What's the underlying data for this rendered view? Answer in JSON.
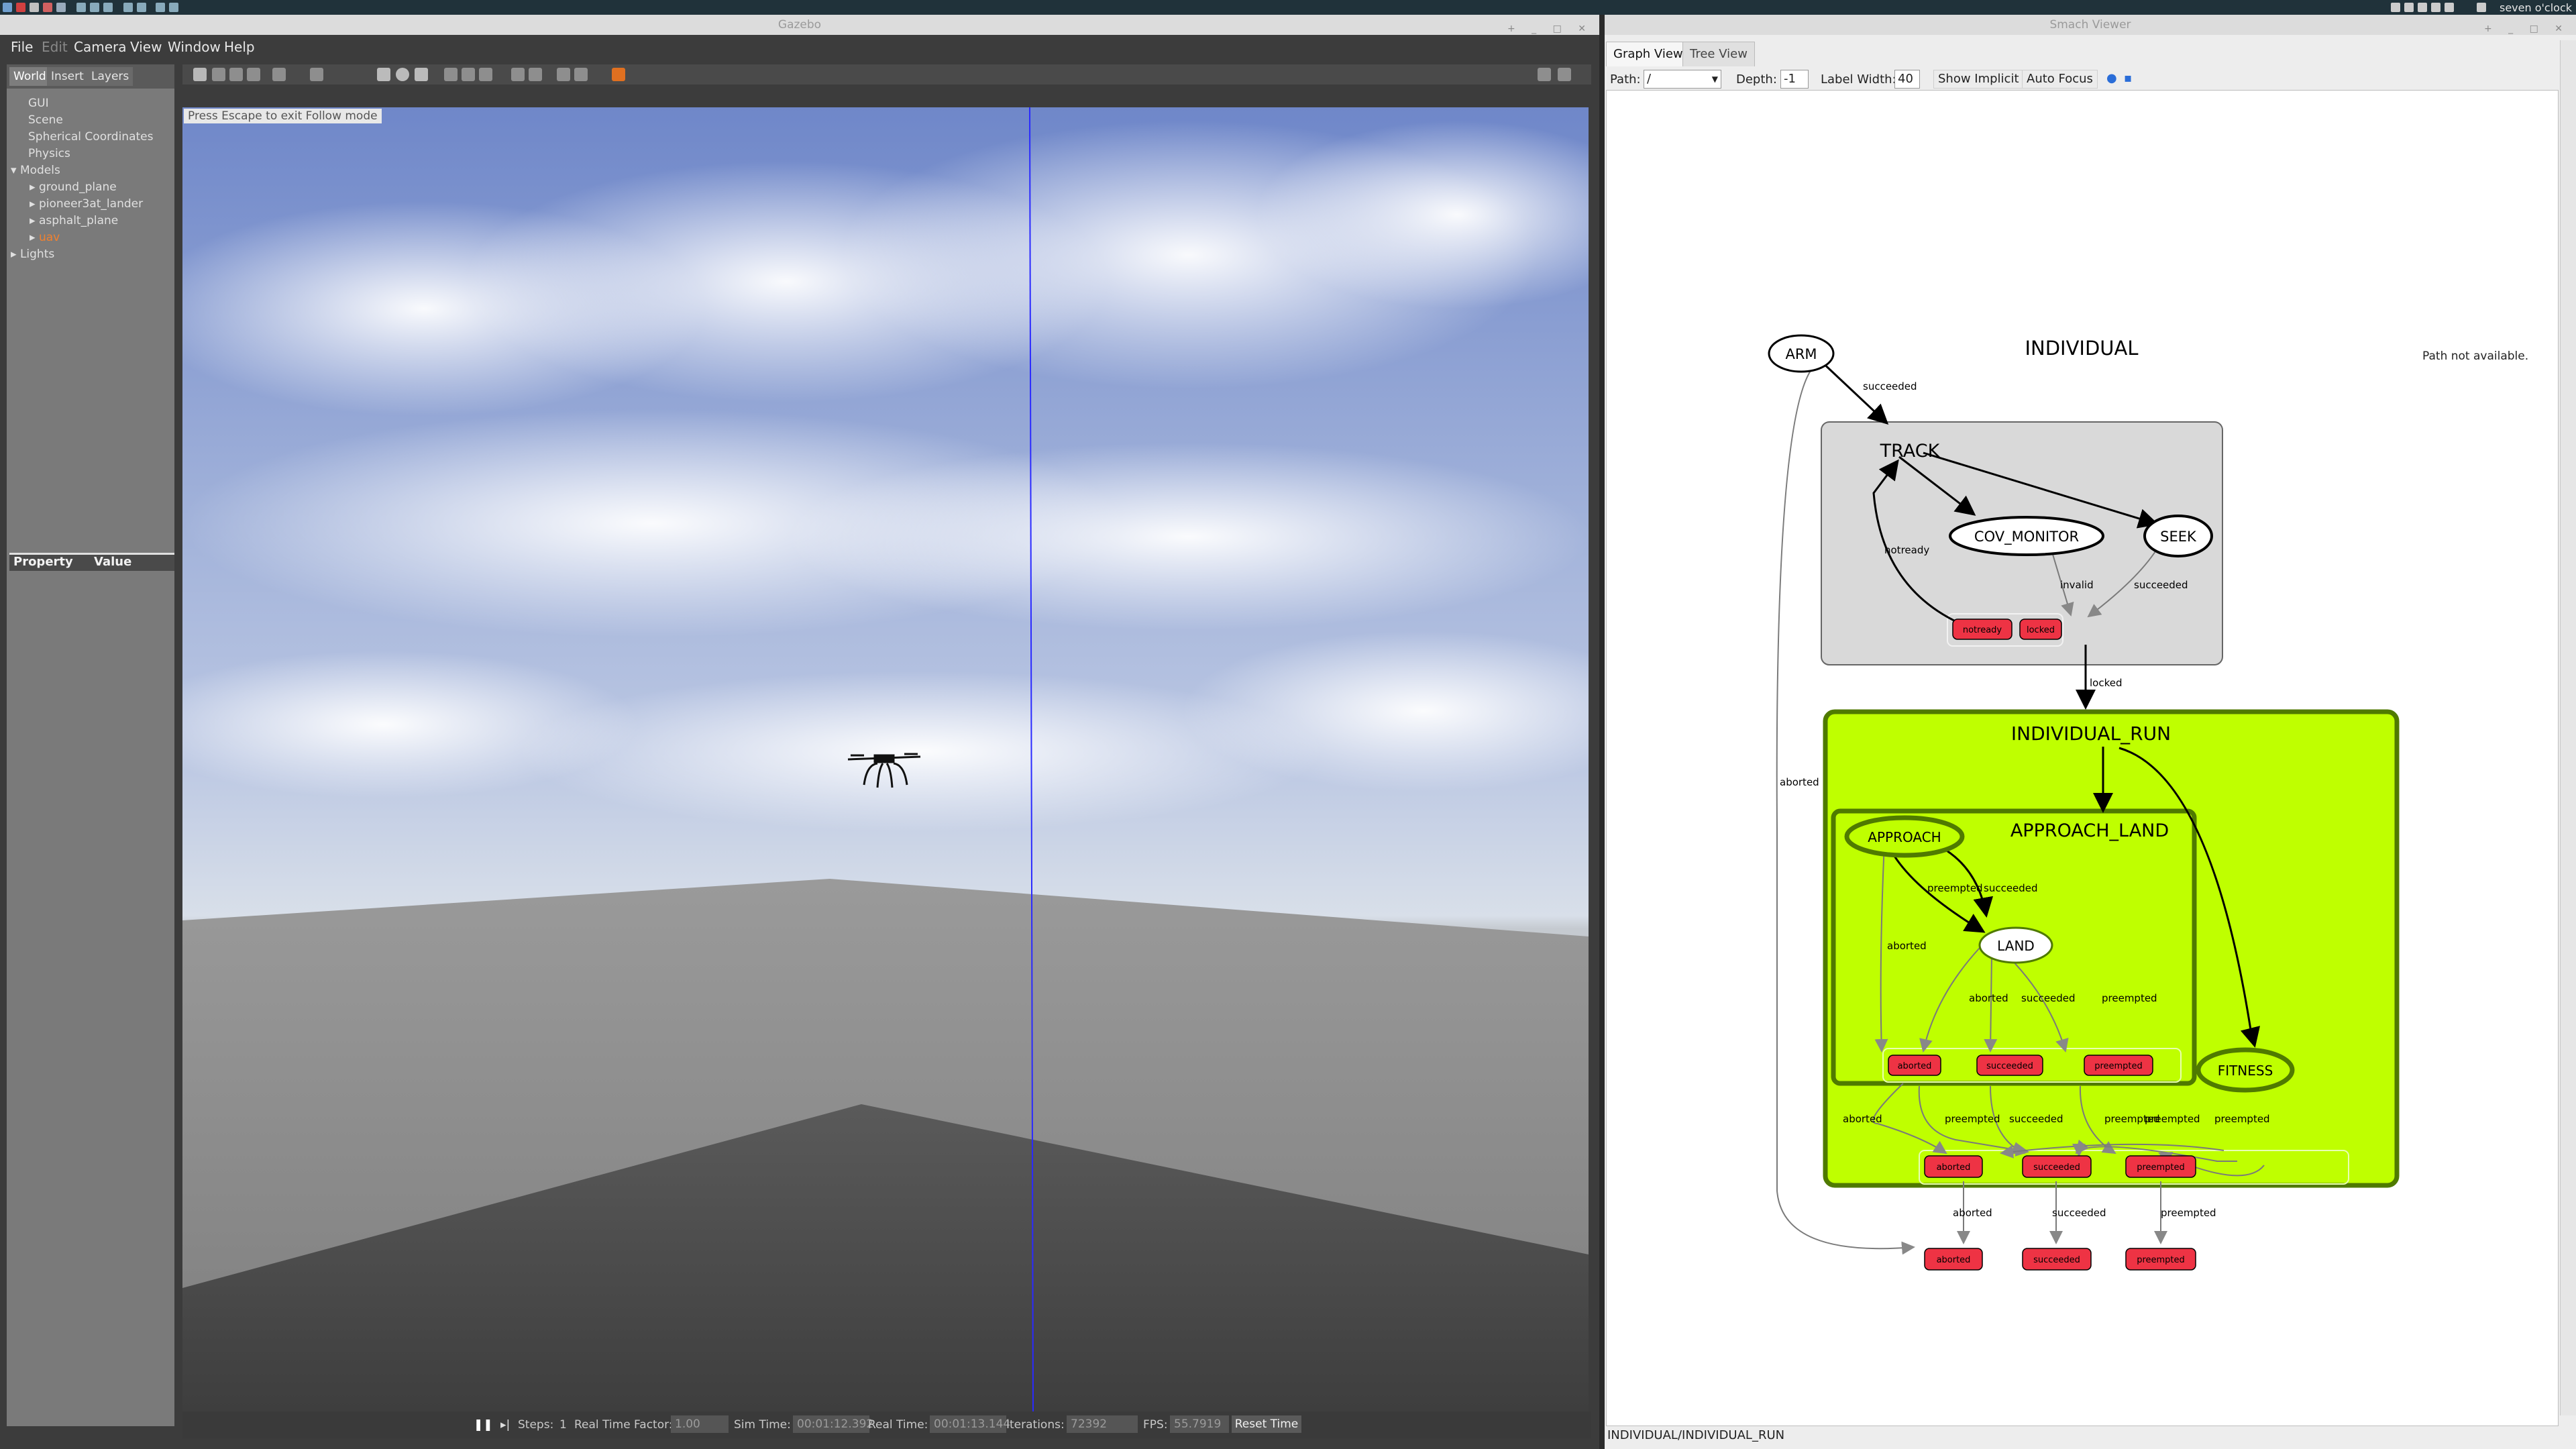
{
  "system_bar": {
    "clock": "seven o'clock"
  },
  "gazebo": {
    "window_title": "Gazebo",
    "menu": [
      "File",
      "Edit",
      "Camera",
      "View",
      "Window",
      "Help"
    ],
    "tabs": [
      "World",
      "Insert",
      "Layers"
    ],
    "tree": {
      "items": [
        "GUI",
        "Scene",
        "Spherical Coordinates",
        "Physics",
        "Models"
      ],
      "models": [
        "ground_plane",
        "pioneer3at_lander",
        "asphalt_plane",
        "uav"
      ],
      "lights": "Lights"
    },
    "properties": {
      "property_header": "Property",
      "value_header": "Value"
    },
    "viewport": {
      "escape_hint": "Press Escape to exit Follow mode"
    },
    "status": {
      "steps_label": "Steps:",
      "steps_value": "1",
      "rtf_label": "Real Time Factor:",
      "rtf_value": "1.00",
      "sim_time_label": "Sim Time:",
      "sim_time_value": "00:01:12.392",
      "real_time_label": "Real Time:",
      "real_time_value": "00:01:13.144",
      "iterations_label": "Iterations:",
      "iterations_value": "72392",
      "fps_label": "FPS:",
      "fps_value": "55.7919",
      "reset_time": "Reset Time"
    }
  },
  "smach": {
    "window_title": "Smach Viewer",
    "tabs": [
      "Graph View",
      "Tree View"
    ],
    "toolbar": {
      "path_label": "Path:",
      "path_value": "/",
      "depth_label": "Depth:",
      "depth_value": "-1",
      "label_width_label": "Label Width:",
      "label_width_value": "40",
      "show_implicit": "Show Implicit",
      "auto_focus": "Auto Focus"
    },
    "path_not_available": "Path not available.",
    "status_path": "INDIVIDUAL/INDIVIDUAL_RUN",
    "graph": {
      "root_title": "INDIVIDUAL",
      "containers": {
        "track": "TRACK",
        "individual_run": "INDIVIDUAL_RUN",
        "approach_land": "APPROACH_LAND"
      },
      "states": {
        "arm": "ARM",
        "cov_monitor": "COV_MONITOR",
        "seek": "SEEK",
        "approach": "APPROACH",
        "land": "LAND",
        "fitness": "FITNESS"
      },
      "outcomes": {
        "notready": "notready",
        "locked": "locked",
        "aborted": "aborted",
        "succeeded": "succeeded",
        "preempted": "preempted"
      },
      "edge_labels": {
        "succeeded": "succeeded",
        "notready": "notready",
        "invalid": "invalid",
        "locked": "locked",
        "aborted": "aborted",
        "preempted": "preempted"
      }
    },
    "colors": {
      "outcome_fill": "#ee3344",
      "active_container": "#bfff00",
      "container_gray": "#d9d9d9"
    }
  }
}
